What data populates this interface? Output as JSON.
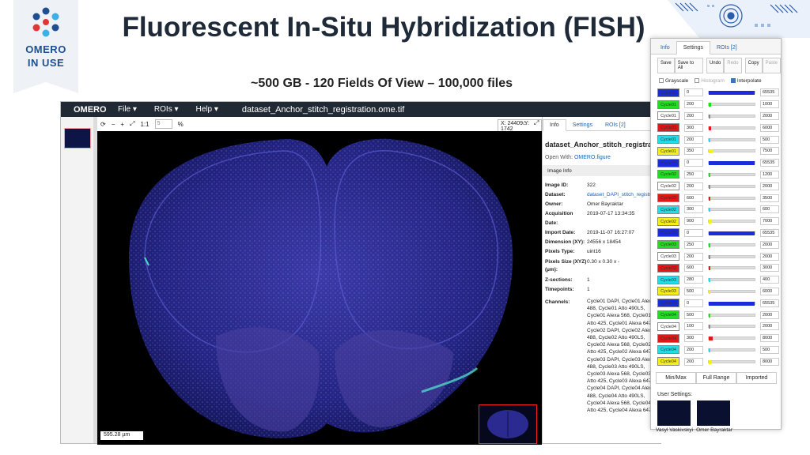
{
  "logo": {
    "line1": "OMERO",
    "line2": "IN USE"
  },
  "title": "Fluorescent In-Situ Hybridization (FISH)",
  "subtitle": "~500 GB - 120 Fields Of View – 100,000 files",
  "viewer": {
    "app_name": "OMERO",
    "menus": [
      "File ▾",
      "ROIs ▾",
      "Help ▾"
    ],
    "filename": "dataset_Anchor_stitch_registration.ome.tif",
    "toolbar": {
      "ratio": "1:1",
      "zoom_value": "5",
      "zoom_unit": "%",
      "coords": "X: 24409 Y: 1742"
    },
    "scale_label": "595.28 µm"
  },
  "right_pane": {
    "tabs": [
      "Info",
      "Settings",
      "ROIs [2]"
    ],
    "image_name": "dataset_Anchor_stitch_registratio",
    "open_with_label": "Open With:",
    "open_with_link": "OMERO.figure",
    "image_info_header": "Image Info",
    "info": [
      {
        "k": "Image ID:",
        "v": "322"
      },
      {
        "k": "Dataset:",
        "v": "dataset_DAPI_stitch_registrati"
      },
      {
        "k": "Owner:",
        "v": "Omer Bayraktar"
      },
      {
        "k": "Acquisition Date:",
        "v": "2019-07-17 13:34:35"
      },
      {
        "k": "Import Date:",
        "v": "2019-11-07 16:27:07"
      },
      {
        "k": "Dimension (XY):",
        "v": "24556 x 18454"
      },
      {
        "k": "Pixels Type:",
        "v": "uint16"
      },
      {
        "k": "Pixels Size (XYZ) (µm):",
        "v": "0.30 x 0.30 x -"
      },
      {
        "k": "Z-sections:",
        "v": "1"
      },
      {
        "k": "Timepoints:",
        "v": "1"
      }
    ],
    "channels_label": "Channels:",
    "channels_value": "Cycle01 DAPI, Cycle01 Alexa 488, Cycle01 Atto 490LS, Cycle01 Alexa 568, Cycle01 Atto 425, Cycle01 Alexa 647, Cycle02 DAPI, Cycle02 Alexa 488, Cycle02 Atto 490LS, Cycle02 Alexa 568, Cycle02 Atto 425, Cycle02 Alexa 647, Cycle03 DAPI, Cycle03 Alexa 488, Cycle03 Atto 490LS, Cycle03 Alexa 568, Cycle03 Atto 425, Cycle03 Alexa 647, Cycle04 DAPI, Cycle04 Alexa 488, Cycle04 Atto 490LS, Cycle04 Alexa 568, Cycle04 Atto 425, Cycle04 Alexa 647"
  },
  "settings_panel": {
    "tabs": [
      "Info",
      "Settings",
      "ROIs [2]"
    ],
    "buttons": [
      "Save",
      "Save to All",
      "Undo",
      "Redo",
      "Copy",
      "Paste"
    ],
    "grayscale": "Grayscale",
    "histogram": "Histogram",
    "interpolate": "Interpolate",
    "channels": [
      {
        "label": "Cycle01",
        "color": "#1a2bd9",
        "min": "0",
        "max": "65535",
        "fill": 1.0
      },
      {
        "label": "Cycle01",
        "color": "#22dd22",
        "min": "200",
        "max": "1000",
        "fill": 0.05
      },
      {
        "label": "Cycle01",
        "color": "#ffffff",
        "min": "200",
        "max": "2000",
        "fill": 0.02
      },
      {
        "label": "Cycle01",
        "color": "#e01818",
        "min": "300",
        "max": "6000",
        "fill": 0.05
      },
      {
        "label": "Cycle01",
        "color": "#22dde8",
        "min": "200",
        "max": "500",
        "fill": 0.02
      },
      {
        "label": "Cycle01",
        "color": "#f5ef18",
        "min": "350",
        "max": "7500",
        "fill": 0.08
      },
      {
        "label": "Cycle02",
        "color": "#1a2bd9",
        "min": "0",
        "max": "65535",
        "fill": 1.0
      },
      {
        "label": "Cycle02",
        "color": "#22dd22",
        "min": "250",
        "max": "1200",
        "fill": 0.02
      },
      {
        "label": "Cycle02",
        "color": "#ffffff",
        "min": "200",
        "max": "2000",
        "fill": 0.02
      },
      {
        "label": "Cycle02",
        "color": "#e01818",
        "min": "600",
        "max": "3500",
        "fill": 0.02
      },
      {
        "label": "Cycle02",
        "color": "#22dde8",
        "min": "300",
        "max": "600",
        "fill": 0.02
      },
      {
        "label": "Cycle02",
        "color": "#f5ef18",
        "min": "900",
        "max": "7000",
        "fill": 0.05
      },
      {
        "label": "Cycle03",
        "color": "#1a2bd9",
        "min": "0",
        "max": "65535",
        "fill": 1.0
      },
      {
        "label": "Cycle03",
        "color": "#22dd22",
        "min": "250",
        "max": "2000",
        "fill": 0.02
      },
      {
        "label": "Cycle03",
        "color": "#ffffff",
        "min": "200",
        "max": "2000",
        "fill": 0.02
      },
      {
        "label": "Cycle03",
        "color": "#e01818",
        "min": "600",
        "max": "3000",
        "fill": 0.02
      },
      {
        "label": "Cycle03",
        "color": "#22dde8",
        "min": "280",
        "max": "400",
        "fill": 0.02
      },
      {
        "label": "Cycle03",
        "color": "#f5ef18",
        "min": "500",
        "max": "6000",
        "fill": 0.04
      },
      {
        "label": "Cycle04",
        "color": "#1a2bd9",
        "min": "0",
        "max": "65535",
        "fill": 1.0
      },
      {
        "label": "Cycle04",
        "color": "#22dd22",
        "min": "500",
        "max": "2000",
        "fill": 0.02
      },
      {
        "label": "Cycle04",
        "color": "#ffffff",
        "min": "100",
        "max": "2000",
        "fill": 0.02
      },
      {
        "label": "Cycle04",
        "color": "#e01818",
        "min": "300",
        "max": "8000",
        "fill": 0.08
      },
      {
        "label": "Cycle04",
        "color": "#22dde8",
        "min": "200",
        "max": "500",
        "fill": 0.02
      },
      {
        "label": "Cycle04",
        "color": "#f5ef18",
        "min": "200",
        "max": "8000",
        "fill": 0.06
      }
    ],
    "range_buttons": [
      "Min/Max",
      "Full Range",
      "Imported"
    ],
    "user_settings_label": "User Settings:",
    "users": [
      "Vasyl Vaskivskyi",
      "Omer Bayraktar"
    ]
  }
}
